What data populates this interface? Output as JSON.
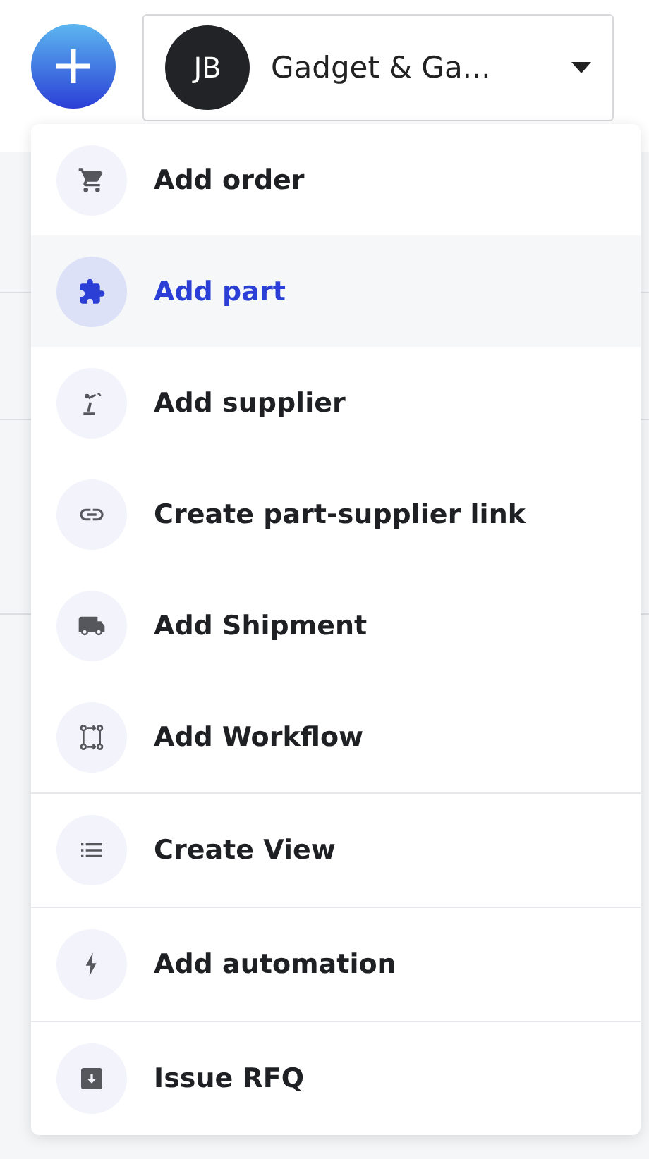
{
  "header": {
    "org": {
      "initials": "JB",
      "name": "Gadget & Ga...",
      "expanded": true
    }
  },
  "menu": {
    "groups": [
      [
        {
          "kind": "cart",
          "label": "Add order",
          "selected": false
        },
        {
          "kind": "puzzle",
          "label": "Add part",
          "selected": true
        },
        {
          "kind": "robot",
          "label": "Add supplier",
          "selected": false
        },
        {
          "kind": "link",
          "label": "Create part-supplier link",
          "selected": false
        },
        {
          "kind": "truck",
          "label": "Add Shipment",
          "selected": false
        },
        {
          "kind": "workflow",
          "label": "Add Workflow",
          "selected": false
        }
      ],
      [
        {
          "kind": "list",
          "label": "Create View",
          "selected": false
        }
      ],
      [
        {
          "kind": "bolt",
          "label": "Add automation",
          "selected": false
        }
      ],
      [
        {
          "kind": "inbox",
          "label": "Issue RFQ",
          "selected": false
        }
      ]
    ]
  }
}
